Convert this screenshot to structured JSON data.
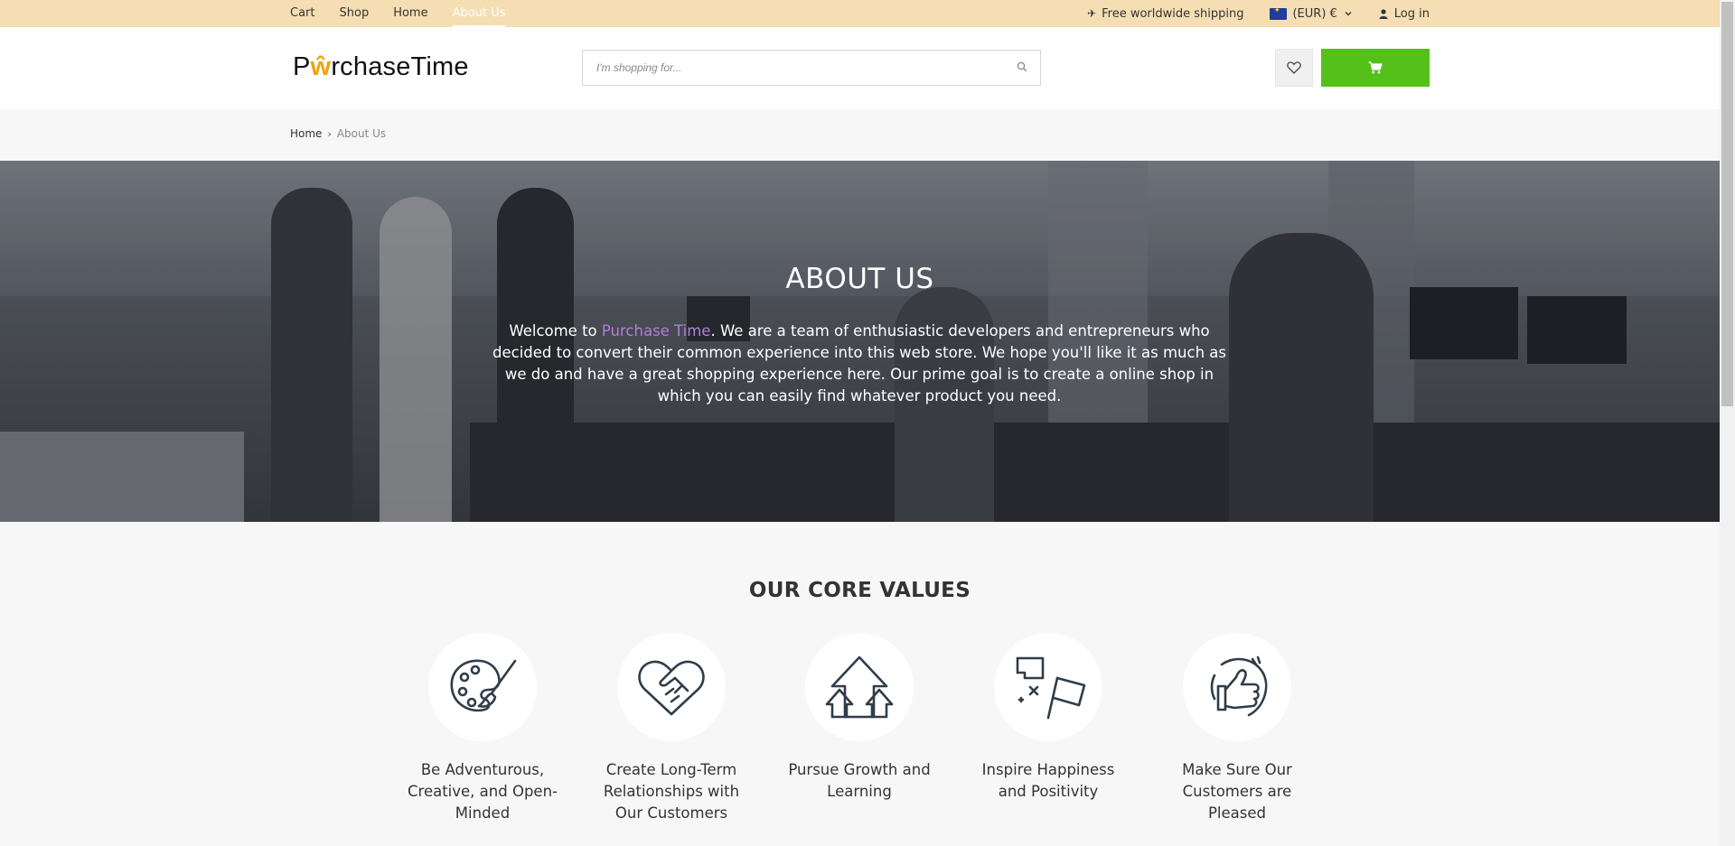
{
  "topbar": {
    "nav": [
      "Cart",
      "Shop",
      "Home",
      "About Us"
    ],
    "active_index": 3,
    "shipping": "Free worldwide shipping",
    "currency": "(EUR) €",
    "login": "Log in"
  },
  "header": {
    "logo_pre": "P",
    "logo_mid": "ŵ",
    "logo_post": "rchaseTime",
    "search_placeholder": "I'm shopping for...",
    "accent": "#54c01a"
  },
  "breadcrumb": {
    "home": "Home",
    "current": "About Us"
  },
  "hero": {
    "title": "ABOUT US",
    "text_pre": "Welcome to ",
    "brand": "Purchase Time",
    "text_post": ". We are a team of enthusiastic developers and entrepreneurs who decided to convert their common experience into this web store. We hope you'll like it as much as we do and have a great shopping experience here. Our prime goal is to create a online shop in which you can easily find whatever product you need."
  },
  "core_values": {
    "title": "OUR CORE VALUES",
    "items": [
      {
        "label": "Be Adventurous, Creative, and Open-Minded",
        "icon": "palette-icon"
      },
      {
        "label": "Create Long-Term Relationships with Our Customers",
        "icon": "handshake-heart-icon"
      },
      {
        "label": "Pursue Growth and Learning",
        "icon": "growth-arrows-icon"
      },
      {
        "label": "Inspire Happiness and Positivity",
        "icon": "flags-icon"
      },
      {
        "label": "Make Sure Our Customers are Pleased",
        "icon": "thumbs-up-icon"
      }
    ]
  }
}
